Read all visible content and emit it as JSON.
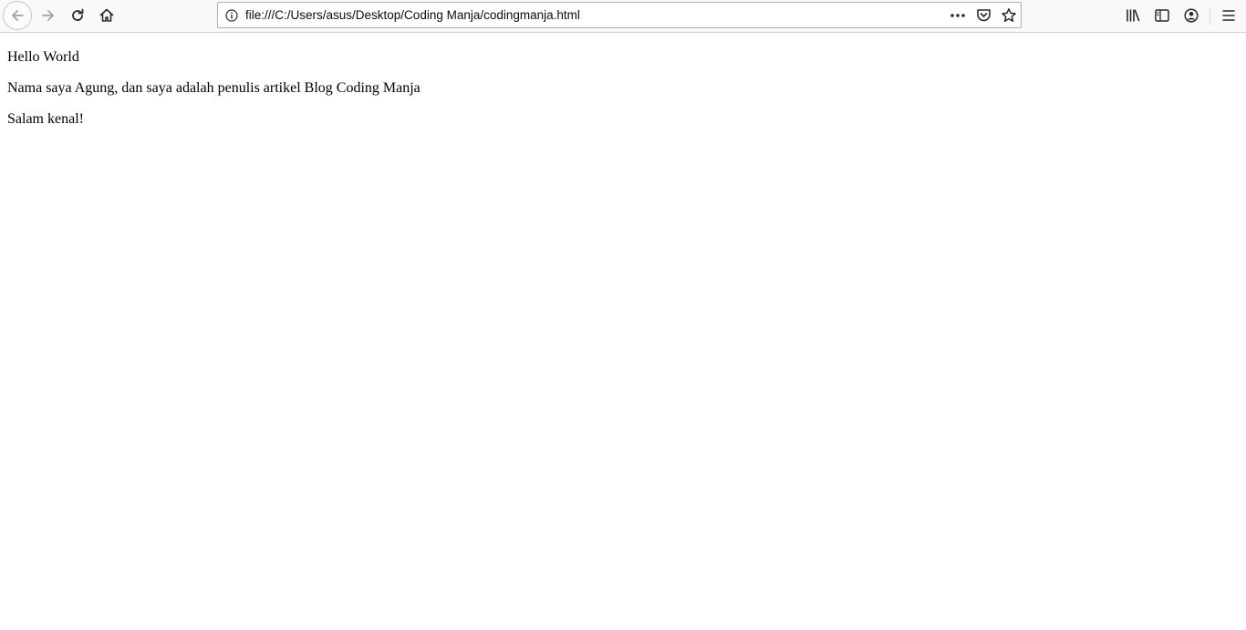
{
  "browser": {
    "url": "file:///C:/Users/asus/Desktop/Coding Manja/codingmanja.html",
    "icons": {
      "back": "back-arrow-icon",
      "forward": "forward-arrow-icon",
      "reload": "reload-icon",
      "home": "home-icon",
      "info": "info-icon",
      "page_actions": "more-dots-icon",
      "pocket": "pocket-icon",
      "bookmark": "star-icon",
      "library": "library-icon",
      "sidebar": "sidebar-icon",
      "account": "account-icon",
      "menu": "hamburger-menu-icon"
    }
  },
  "page": {
    "lines": [
      "Hello World",
      "Nama saya Agung, dan saya adalah penulis artikel Blog Coding Manja",
      "Salam kenal!"
    ]
  },
  "colors": {
    "toolbar_bg": "#f9f9fa",
    "icon": "#2a2a2e",
    "disabled_icon": "#a0a0a5",
    "text": "#000000"
  }
}
